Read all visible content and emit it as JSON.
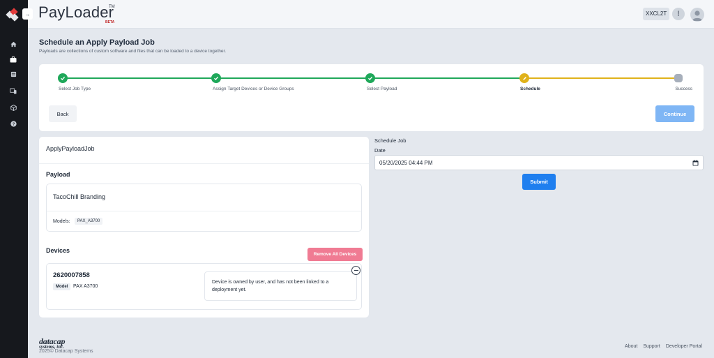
{
  "app": {
    "name": "PayLoader",
    "trademark": "TM",
    "badge": "BETA",
    "user_code": "XXCL2T",
    "alert_symbol": "!"
  },
  "sidebar": {
    "items": [
      {
        "icon": "home-icon"
      },
      {
        "icon": "briefcase-icon",
        "active": true
      },
      {
        "icon": "inbox-icon"
      },
      {
        "icon": "devices-icon"
      },
      {
        "icon": "package-icon"
      },
      {
        "icon": "help-icon"
      }
    ]
  },
  "page": {
    "title": "Schedule an Apply Payload Job",
    "subtitle": "Payloads are collections of custom software and files that can be loaded to a device together."
  },
  "stepper": {
    "steps": [
      {
        "label": "Select Job Type",
        "status": "done"
      },
      {
        "label": "Assign Target Devices or Device Groups",
        "status": "done"
      },
      {
        "label": "Select Payload",
        "status": "done"
      },
      {
        "label": "Schedule",
        "status": "current"
      },
      {
        "label": "Success",
        "status": "todo"
      }
    ],
    "back_label": "Back",
    "continue_label": "Continue"
  },
  "job": {
    "name": "ApplyPayloadJob",
    "payload_section": "Payload",
    "payload_name": "TacoChill Branding",
    "models_label": "Models:",
    "models_value": "PAX_A3700",
    "devices_section": "Devices",
    "remove_all_label": "Remove All Devices",
    "device": {
      "id": "2620007858",
      "model_label": "Model",
      "model_value": "PAX A3700",
      "note": "Device is owned by user, and has not been linked to a deployment yet."
    }
  },
  "schedule": {
    "title": "Schedule Job",
    "date_label": "Date",
    "date_value": "05/20/2025 04:44 PM",
    "submit_label": "Submit"
  },
  "footer": {
    "logo_line1": "datacap",
    "logo_line2": "systems, inc.",
    "copyright": "2025©  Datacap Systems",
    "links": [
      "About",
      "Support",
      "Developer Portal"
    ]
  },
  "colors": {
    "done": "#1fa85a",
    "current": "#e0b21a",
    "todo": "#a7afbb",
    "primary": "#1f7fef",
    "danger": "#f07b93"
  }
}
